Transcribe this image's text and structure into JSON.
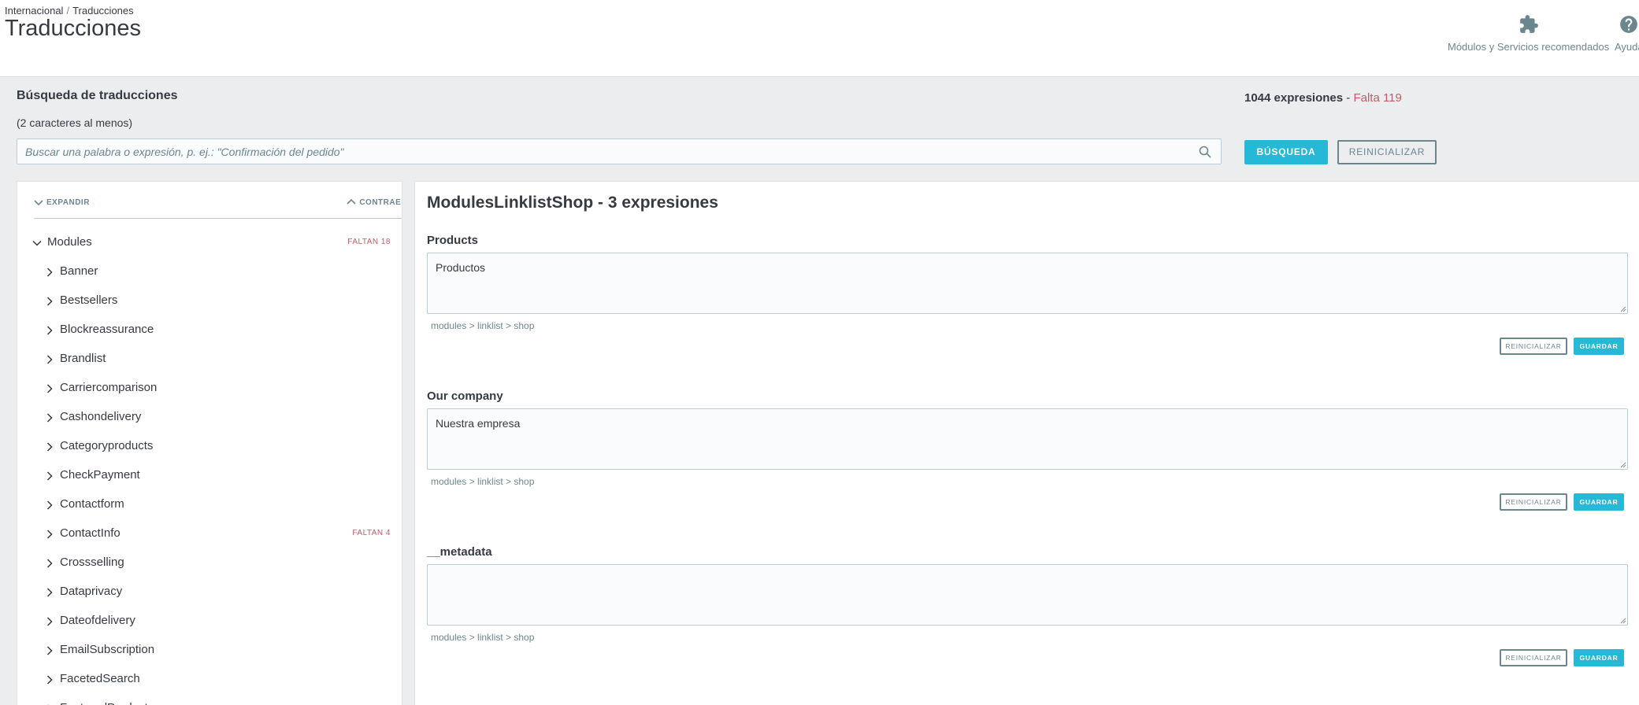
{
  "header": {
    "breadcrumb": [
      "Internacional",
      "Traducciones"
    ],
    "breadcrumb_sep": "/",
    "title": "Traducciones",
    "toolbar": {
      "modules_label": "Módulos y Servicios recomendados",
      "modules_icon": "puzzle-icon",
      "help_label": "Ayuda",
      "help_icon": "help-icon"
    }
  },
  "search": {
    "title": "Búsqueda de traducciones",
    "hint": "(2 caracteres al menos)",
    "placeholder": "Buscar una palabra o expresión, p. ej.: \"Confirmación del pedido\"",
    "value": "",
    "search_button": "BÚSQUEDA",
    "reset_button": "REINICIALIZAR",
    "total": "1044 expresiones",
    "separator": " - ",
    "missing": "Falta 119"
  },
  "tree": {
    "expand_label": "EXPANDIR",
    "collapse_label": "CONTRAER",
    "root": {
      "label": "Modules",
      "badge": "FALTAN 18"
    },
    "children": [
      {
        "label": "Banner",
        "badge": ""
      },
      {
        "label": "Bestsellers",
        "badge": ""
      },
      {
        "label": "Blockreassurance",
        "badge": ""
      },
      {
        "label": "Brandlist",
        "badge": ""
      },
      {
        "label": "Carriercomparison",
        "badge": ""
      },
      {
        "label": "Cashondelivery",
        "badge": ""
      },
      {
        "label": "Categoryproducts",
        "badge": ""
      },
      {
        "label": "CheckPayment",
        "badge": ""
      },
      {
        "label": "Contactform",
        "badge": ""
      },
      {
        "label": "ContactInfo",
        "badge": "FALTAN 4"
      },
      {
        "label": "Crossselling",
        "badge": ""
      },
      {
        "label": "Dataprivacy",
        "badge": ""
      },
      {
        "label": "Dateofdelivery",
        "badge": ""
      },
      {
        "label": "EmailSubscription",
        "badge": ""
      },
      {
        "label": "FacetedSearch",
        "badge": ""
      },
      {
        "label": "FeaturedProducts",
        "badge": ""
      }
    ]
  },
  "content": {
    "title": "ModulesLinklistShop - 3 expresiones",
    "expressions": [
      {
        "label": "Products",
        "value": "Productos",
        "path": "modules > linklist > shop",
        "reset": "REINICIALIZAR",
        "save": "GUARDAR"
      },
      {
        "label": "Our company",
        "value": "Nuestra empresa",
        "path": "modules > linklist > shop",
        "reset": "REINICIALIZAR",
        "save": "GUARDAR"
      },
      {
        "label": "__metadata",
        "value": "",
        "path": "modules > linklist > shop",
        "reset": "REINICIALIZAR",
        "save": "GUARDAR"
      }
    ]
  },
  "colors": {
    "accent": "#25b9d7",
    "missing": "#c05c67",
    "text": "#363a41",
    "muted": "#6c868e",
    "background": "#ebedef"
  }
}
